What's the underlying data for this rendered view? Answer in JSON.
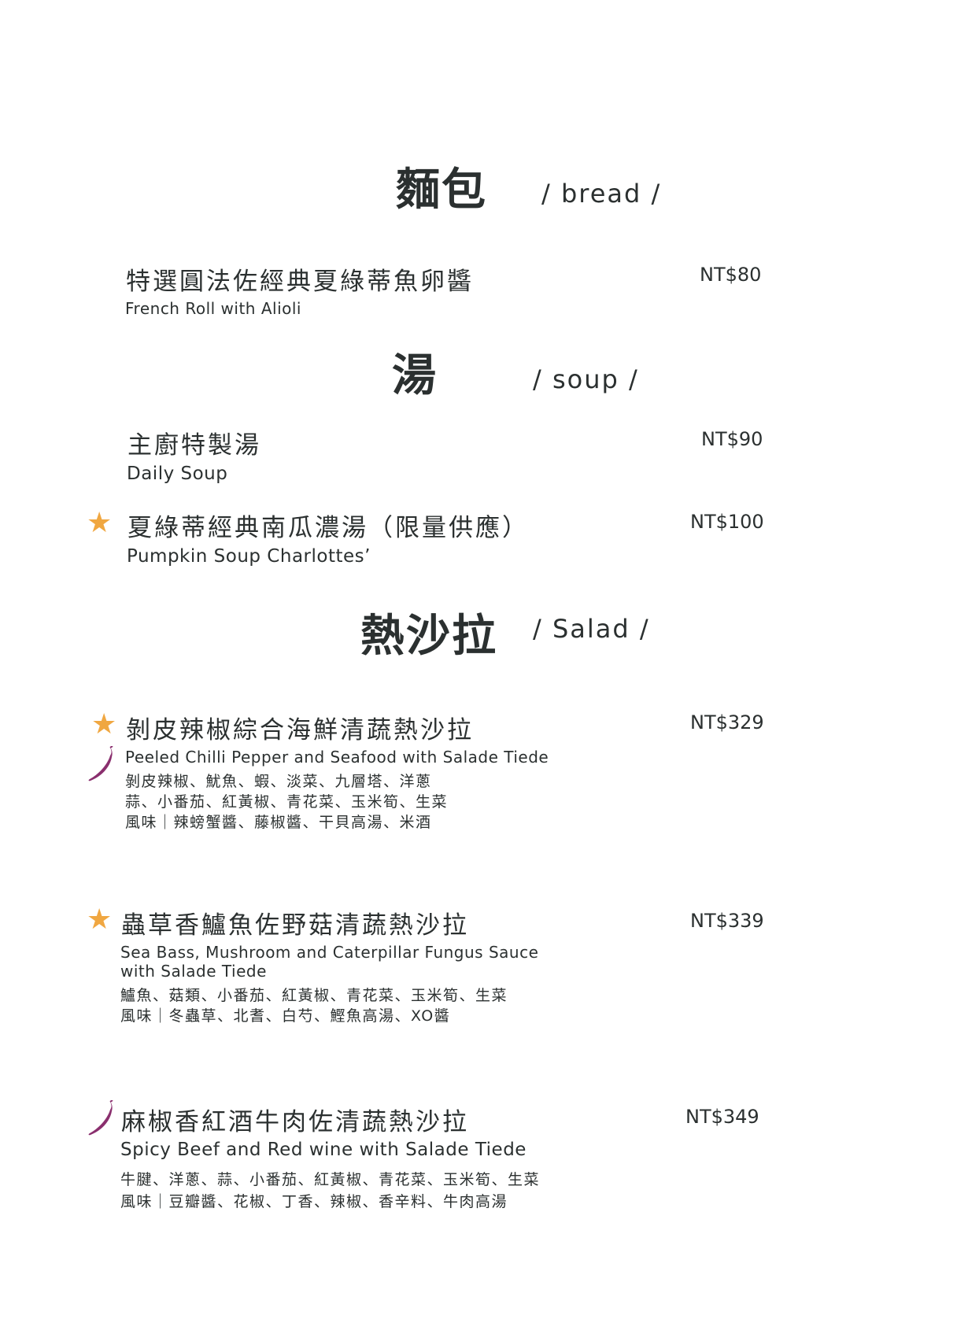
{
  "sections": {
    "bread": {
      "title_cn": "麵包",
      "title_en": "/ bread /",
      "items": [
        {
          "name_cn": "特選圓法佐經典夏綠蒂魚卵醬",
          "name_en": "French Roll with Alioli",
          "price": "NT$80"
        }
      ]
    },
    "soup": {
      "title_cn": "湯",
      "title_en": "/ soup /",
      "items": [
        {
          "name_cn": "主廚特製湯",
          "name_en": "Daily Soup",
          "price": "NT$90"
        },
        {
          "name_cn": "夏綠蒂經典南瓜濃湯（限量供應）",
          "name_en": "Pumpkin Soup Charlottes’",
          "price": "NT$100",
          "badges": [
            "star-icon"
          ]
        }
      ]
    },
    "salad": {
      "title_cn": "熱沙拉",
      "title_en": "/ Salad /",
      "items": [
        {
          "name_cn": "剝皮辣椒綜合海鮮清蔬熱沙拉",
          "name_en": "Peeled Chilli Pepper and Seafood with Salade Tiede",
          "price": "NT$329",
          "badges": [
            "star-icon",
            "chili-pepper-icon"
          ],
          "ingredients": [
            "剝皮辣椒、魷魚、蝦、淡菜、九層塔、洋蔥",
            "蒜、小番茄、紅黃椒、青花菜、玉米筍、生菜",
            "風味｜辣螃蟹醬、藤椒醬、干貝高湯、米酒"
          ]
        },
        {
          "name_cn": "蟲草香鱸魚佐野菇清蔬熱沙拉",
          "name_en_lines": [
            "Sea Bass, Mushroom and Caterpillar Fungus Sauce",
            "with Salade Tiede"
          ],
          "price": "NT$339",
          "badges": [
            "star-icon"
          ],
          "ingredients": [
            "鱸魚、菇類、小番茄、紅黃椒、青花菜、玉米筍、生菜",
            "風味｜冬蟲草、北耆、白芍、鰹魚高湯、XO醬"
          ]
        },
        {
          "name_cn": "麻椒香紅酒牛肉佐清蔬熱沙拉",
          "name_en": "Spicy Beef and Red wine with Salade Tiede",
          "price": "NT$349",
          "badges": [
            "chili-pepper-icon"
          ],
          "ingredients": [
            "牛腱、洋蔥、蒜、小番茄、紅黃椒、青花菜、玉米筍、生菜",
            "風味｜豆瓣醬、花椒、丁香、辣椒、香辛料、牛肉高湯"
          ]
        }
      ]
    }
  },
  "colors": {
    "star": "#f0a741",
    "chili": "#8a2f6e",
    "text": "#2b3030"
  }
}
